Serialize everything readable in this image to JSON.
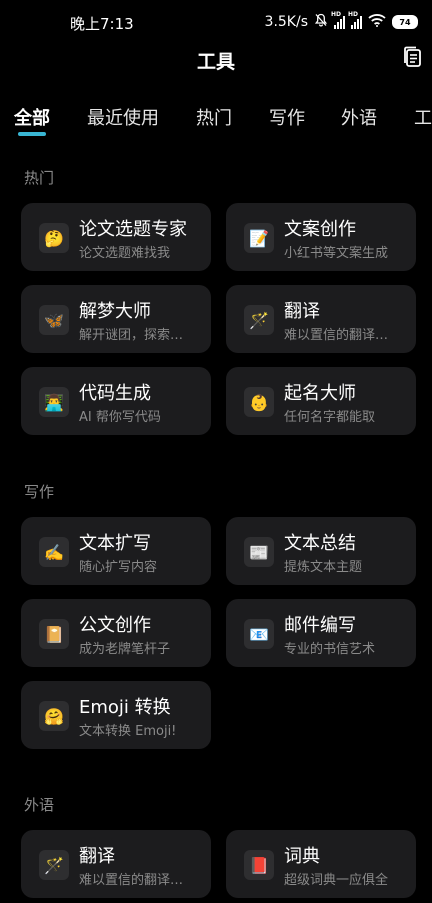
{
  "status": {
    "time": "晚上7:13",
    "net_speed": "3.5K/s",
    "battery": "74",
    "hd1": "HD",
    "hd2": "HD"
  },
  "header": {
    "title": "工具"
  },
  "tabs": [
    {
      "label": "全部",
      "active": true
    },
    {
      "label": "最近使用"
    },
    {
      "label": "热门"
    },
    {
      "label": "写作"
    },
    {
      "label": "外语"
    },
    {
      "label": "工"
    }
  ],
  "sections": {
    "hot": {
      "title": "热门",
      "cards": [
        {
          "title": "论文选题专家",
          "sub": "论文选题难找我",
          "icon": "🤔"
        },
        {
          "title": "文案创作",
          "sub": "小红书等文案生成",
          "icon": "📝"
        },
        {
          "title": "解梦大师",
          "sub": "解开谜团，探索…",
          "icon": "🦋"
        },
        {
          "title": "翻译",
          "sub": "难以置信的翻译…",
          "icon": "🪄"
        },
        {
          "title": "代码生成",
          "sub": "AI 帮你写代码",
          "icon": "👨‍💻"
        },
        {
          "title": "起名大师",
          "sub": "任何名字都能取",
          "icon": "👶"
        }
      ]
    },
    "writing": {
      "title": "写作",
      "cards": [
        {
          "title": "文本扩写",
          "sub": "随心扩写内容",
          "icon": "✍️"
        },
        {
          "title": "文本总结",
          "sub": "提炼文本主题",
          "icon": "📰"
        },
        {
          "title": "公文创作",
          "sub": "成为老牌笔杆子",
          "icon": "📔"
        },
        {
          "title": "邮件编写",
          "sub": "专业的书信艺术",
          "icon": "📧"
        },
        {
          "title": "Emoji 转换",
          "sub": "文本转换 Emoji!",
          "icon": "🤗"
        }
      ]
    },
    "foreign": {
      "title": "外语",
      "cards": [
        {
          "title": "翻译",
          "sub": "难以置信的翻译…",
          "icon": "🪄"
        },
        {
          "title": "词典",
          "sub": "超级词典一应俱全",
          "icon": "📕"
        }
      ]
    }
  }
}
